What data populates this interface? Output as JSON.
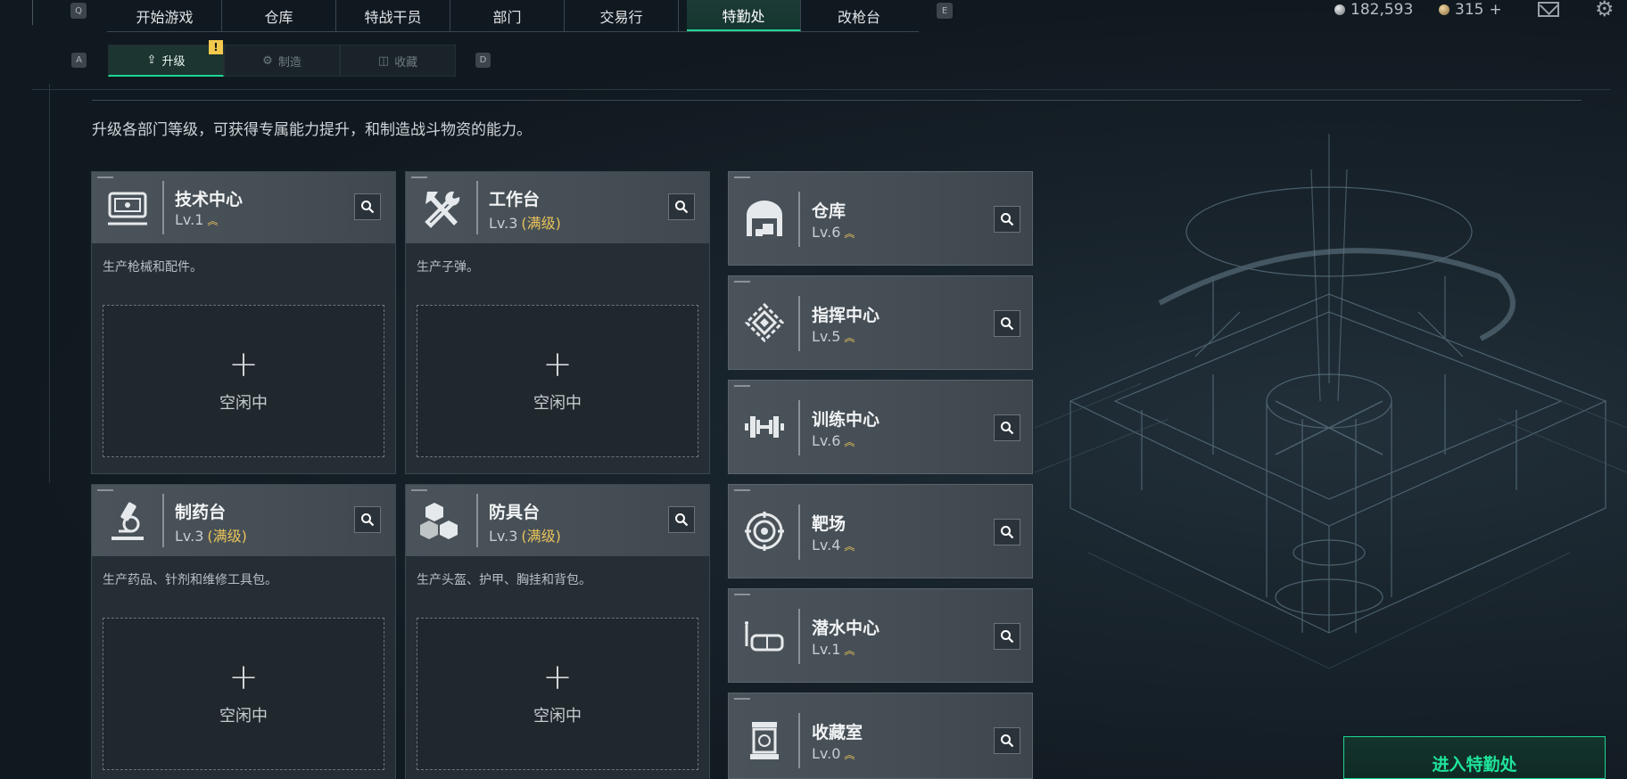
{
  "nav": {
    "left_key": "Q",
    "right_key": "E",
    "tabs": [
      {
        "label": "开始游戏"
      },
      {
        "label": "仓库"
      },
      {
        "label": "特战干员"
      },
      {
        "label": "部门"
      },
      {
        "label": "交易行"
      },
      {
        "label": "特勤处"
      },
      {
        "label": "改枪台"
      }
    ],
    "active_index": 5
  },
  "currency": {
    "silver": "182,593",
    "gold": "315",
    "gold_add": "+"
  },
  "subtabs": {
    "left_key": "A",
    "right_key": "D",
    "items": [
      {
        "label": "升级",
        "icon": "upgrade-icon"
      },
      {
        "label": "制造",
        "icon": "craft-icon"
      },
      {
        "label": "收藏",
        "icon": "collection-icon"
      }
    ],
    "active_index": 0,
    "badge": "!"
  },
  "description": "升级各部门等级，可获得专属能力提升，和制造战斗物资的能力。",
  "production_cards": [
    {
      "name": "技术中心",
      "level": "Lv.1",
      "max": "",
      "desc": "生产枪械和配件。",
      "status": "空闲中",
      "plus": "+",
      "icon": "computer-icon"
    },
    {
      "name": "工作台",
      "level": "Lv.3",
      "max": "(满级)",
      "desc": "生产子弹。",
      "status": "空闲中",
      "plus": "+",
      "icon": "tools-icon"
    },
    {
      "name": "制药台",
      "level": "Lv.3",
      "max": "(满级)",
      "desc": "生产药品、针剂和维修工具包。",
      "status": "空闲中",
      "plus": "+",
      "icon": "microscope-icon"
    },
    {
      "name": "防具台",
      "level": "Lv.3",
      "max": "(满级)",
      "desc": "生产头盔、护甲、胸挂和背包。",
      "status": "空闲中",
      "plus": "+",
      "icon": "boxes-icon"
    }
  ],
  "facility_cards": [
    {
      "name": "仓库",
      "level": "Lv.6",
      "icon": "warehouse-icon"
    },
    {
      "name": "指挥中心",
      "level": "Lv.5",
      "icon": "command-icon"
    },
    {
      "name": "训练中心",
      "level": "Lv.6",
      "icon": "dumbbell-icon"
    },
    {
      "name": "靶场",
      "level": "Lv.4",
      "icon": "target-icon"
    },
    {
      "name": "潜水中心",
      "level": "Lv.1",
      "icon": "diving-mask-icon"
    },
    {
      "name": "收藏室",
      "level": "Lv.0",
      "icon": "collection-room-icon"
    }
  ],
  "enter_button": "进入特勤处"
}
